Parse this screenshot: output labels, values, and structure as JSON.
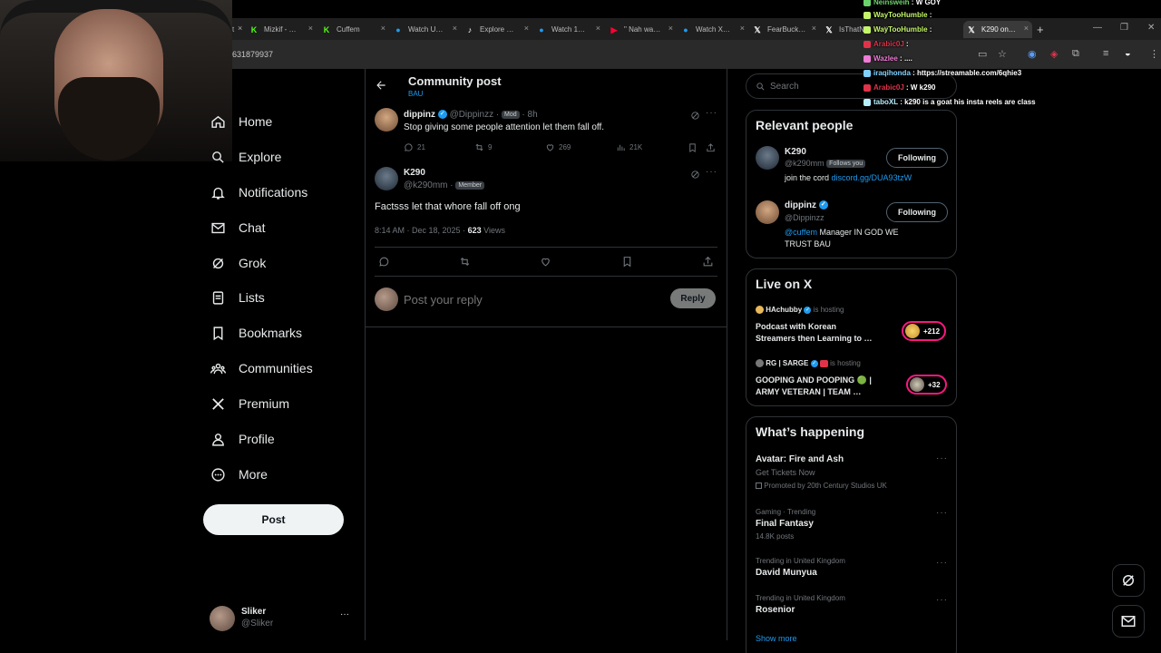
{
  "browser": {
    "tabs": [
      {
        "label": "Mizkif - …",
        "icon": "kick-icon",
        "color": "#53fc18"
      },
      {
        "label": "Cuffem",
        "icon": "kick-icon",
        "color": "#53fc18"
      },
      {
        "label": "Watch U…",
        "icon": "watch-icon",
        "color": "#1d9bf0"
      },
      {
        "label": "Explore …",
        "icon": "tiktok-icon",
        "color": "#ffffff"
      },
      {
        "label": "Watch 1…",
        "icon": "watch-icon",
        "color": "#1d9bf0"
      },
      {
        "label": "\" Nah wa…",
        "icon": "youtube-icon",
        "color": "#ff0033"
      },
      {
        "label": "Watch X…",
        "icon": "watch-icon",
        "color": "#1d9bf0"
      },
      {
        "label": "FearBuck…",
        "icon": "x-icon",
        "color": "#ffffff"
      },
      {
        "label": "IsThatN…",
        "icon": "x-icon",
        "color": "#ffffff"
      },
      {
        "label": "K290 on…",
        "icon": "x-icon",
        "color": "#ffffff"
      }
    ],
    "url": "631879937"
  },
  "sidebar": {
    "items": [
      {
        "label": "Home",
        "icon": "home-icon"
      },
      {
        "label": "Explore",
        "icon": "search-icon"
      },
      {
        "label": "Notifications",
        "icon": "bell-icon"
      },
      {
        "label": "Chat",
        "icon": "mail-icon"
      },
      {
        "label": "Grok",
        "icon": "grok-icon"
      },
      {
        "label": "Lists",
        "icon": "list-icon"
      },
      {
        "label": "Bookmarks",
        "icon": "bookmark-icon"
      },
      {
        "label": "Communities",
        "icon": "communities-icon"
      },
      {
        "label": "Premium",
        "icon": "x-icon"
      },
      {
        "label": "Profile",
        "icon": "person-icon"
      },
      {
        "label": "More",
        "icon": "more-circle-icon"
      }
    ],
    "post_label": "Post",
    "account": {
      "name": "Sliker",
      "handle": "@Sliker",
      "more": "···"
    }
  },
  "header": {
    "title": "Community post",
    "subtitle": "BAU"
  },
  "parent_post": {
    "name": "dippinz",
    "handle": "@Dippinzz",
    "badge": "Mod",
    "sep": "·",
    "time": "8h",
    "text": "Stop giving some people attention let them fall off.",
    "replies": "21",
    "reposts": "9",
    "likes": "269",
    "views": "21K"
  },
  "main_post": {
    "name": "K290",
    "handle": "@k290mm",
    "sep": "·",
    "badge": "Member",
    "text": "Factsss let that whore fall off ong",
    "datetime": "8:14 AM · Dec 18, 2025 ·",
    "views_count": "623",
    "views_label": "Views"
  },
  "reply_box": {
    "placeholder": "Post your reply",
    "button": "Reply"
  },
  "right": {
    "search_placeholder": "Search",
    "relevant": {
      "title": "Relevant people",
      "people": [
        {
          "name": "K290",
          "handle": "@k290mm",
          "follows_you": "Follows you",
          "bio_prefix": "join the cord ",
          "bio_link": "discord.gg/DUA93tzW",
          "button": "Following"
        },
        {
          "name": "dippinz",
          "handle": "@Dippinzz",
          "bio_mention": "@cuffem",
          "bio_rest": " Manager IN GOD WE TRUST BAU",
          "button": "Following"
        }
      ]
    },
    "live": {
      "title": "Live on X",
      "items": [
        {
          "host": "HAchubby",
          "status": "is hosting",
          "title_l1": "Podcast with Korean",
          "title_l2": "Streamers then Learning to …",
          "count": "+212"
        },
        {
          "host": "RG | SARGE",
          "status": "is hosting",
          "title_l1": "GOOPING AND POOPING 🟢 |",
          "title_l2": "ARMY VETERAN | TEAM …",
          "count": "+32"
        }
      ]
    },
    "happening": {
      "title": "What’s happening",
      "items": [
        {
          "context": "",
          "title": "Avatar: Fire and Ash",
          "sub": "Get Tickets Now",
          "promo": "Promoted by 20th Century Studios UK"
        },
        {
          "context": "Gaming · Trending",
          "title": "Final Fantasy",
          "sub": "14.8K posts",
          "promo": ""
        },
        {
          "context": "Trending in United Kingdom",
          "title": "David Munyua",
          "sub": "",
          "promo": ""
        },
        {
          "context": "Trending in United Kingdom",
          "title": "Rosenior",
          "sub": "",
          "promo": ""
        }
      ],
      "show_more": "Show more"
    }
  },
  "chat": [
    {
      "user": "Neinsweih",
      "sep": " : ",
      "msg": "W GOY",
      "color": "#6bd36b"
    },
    {
      "user": "WayTooHumble",
      "sep": " : ",
      "msg": "",
      "color": "#c5f56a"
    },
    {
      "user": "WayTooHumble",
      "sep": " : ",
      "msg": "",
      "color": "#c5f56a"
    },
    {
      "user": "Arabic0J",
      "sep": " : ",
      "msg": "",
      "color": "#e0334a"
    },
    {
      "user": "Wazlee",
      "sep": " : ",
      "msg": "....",
      "color": "#f07bd6"
    },
    {
      "user": "iraqihonda",
      "sep": " : ",
      "msg": "https://streamable.com/6qhie3",
      "color": "#7fd0ff"
    },
    {
      "user": "Arabic0J",
      "sep": " : ",
      "msg": "W k290",
      "color": "#e0334a"
    },
    {
      "user": "taboXL",
      "sep": " : ",
      "msg": "k290 is a goat his insta reels are class",
      "color": "#b6f0ff"
    }
  ],
  "colors": {
    "accent": "#1d9bf0",
    "live": "#f91880",
    "background": "#000000",
    "text": "#e7e9ea",
    "muted": "#71767b",
    "border": "#2f3336"
  }
}
